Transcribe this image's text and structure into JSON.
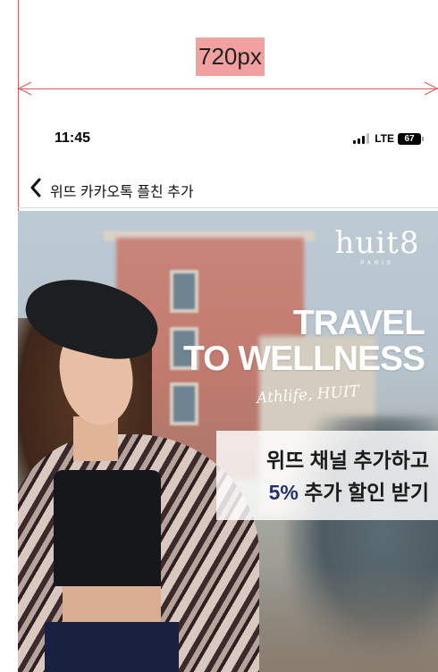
{
  "overlay": {
    "width_label": "720px",
    "accent_color": "#e05a5a"
  },
  "status_bar": {
    "time": "11:45",
    "network": "LTE",
    "battery": "67",
    "signal_icon": "cellular-signal-icon",
    "battery_icon": "battery-icon"
  },
  "nav": {
    "back_icon": "chevron-left-icon",
    "title": "위뜨 카카오톡 플친 추가"
  },
  "banner": {
    "brand": "huit8",
    "brand_sub": "PARIS",
    "headline_line1": "TRAVEL",
    "headline_line2": "TO WELLNESS",
    "tagline": "Athlife, HUIT",
    "promo_line1": "위뜨 채널 추가하고",
    "promo_percent": "5%",
    "promo_line2_rest": " 추가 할인 받기",
    "promo_accent_color": "#22346b"
  }
}
